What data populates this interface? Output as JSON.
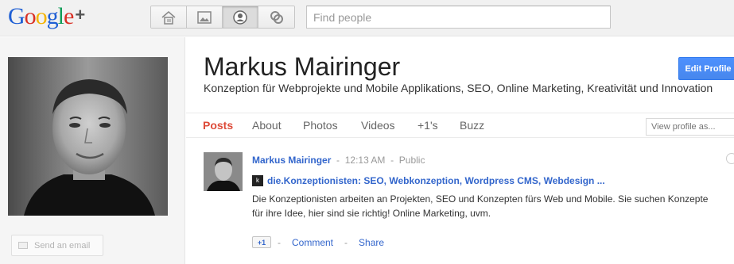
{
  "logo": {
    "google": [
      "G",
      "o",
      "o",
      "g",
      "l",
      "e"
    ],
    "plus": "+"
  },
  "colors": {
    "blue": "#1f5fd4",
    "red": "#d93025",
    "yellow": "#f4b400",
    "green": "#0f9d58",
    "accent_red": "#dd4b39",
    "link_blue": "#3366cc"
  },
  "nav": {
    "items": [
      {
        "icon": "home-icon"
      },
      {
        "icon": "photos-icon"
      },
      {
        "icon": "profile-icon",
        "active": true
      },
      {
        "icon": "circles-icon"
      }
    ]
  },
  "search": {
    "placeholder": "Find people"
  },
  "profile": {
    "name": "Markus Mairinger",
    "tagline": "Konzeption für Webprojekte und Mobile Applikations, SEO, Online Marketing, Kreativität und Innovation",
    "edit_button": "Edit Profile",
    "send_email": "Send an email"
  },
  "tabs": {
    "posts": "Posts",
    "about": "About",
    "photos": "Photos",
    "videos": "Videos",
    "plusones": "+1's",
    "buzz": "Buzz",
    "active": "Posts"
  },
  "view_as": {
    "placeholder": "View profile as..."
  },
  "post": {
    "author": "Markus Mairinger",
    "sep1": "-",
    "time": "12:13 AM",
    "sep2": "-",
    "visibility": "Public",
    "favicon_letter": "k",
    "link_title": "die.Konzeptionisten: SEO, Webkonzeption, Wordpress CMS, Webdesign ...",
    "body": "Die Konzeptionisten arbeiten an Projekten, SEO und Konzepten fürs Web und Mobile. Sie suchen Konzepte für ihre Idee, hier sind sie richtig! Online Marketing, uvm.",
    "plusone_label": "+1",
    "comment_label": "Comment",
    "share_label": "Share",
    "dash": "-"
  }
}
